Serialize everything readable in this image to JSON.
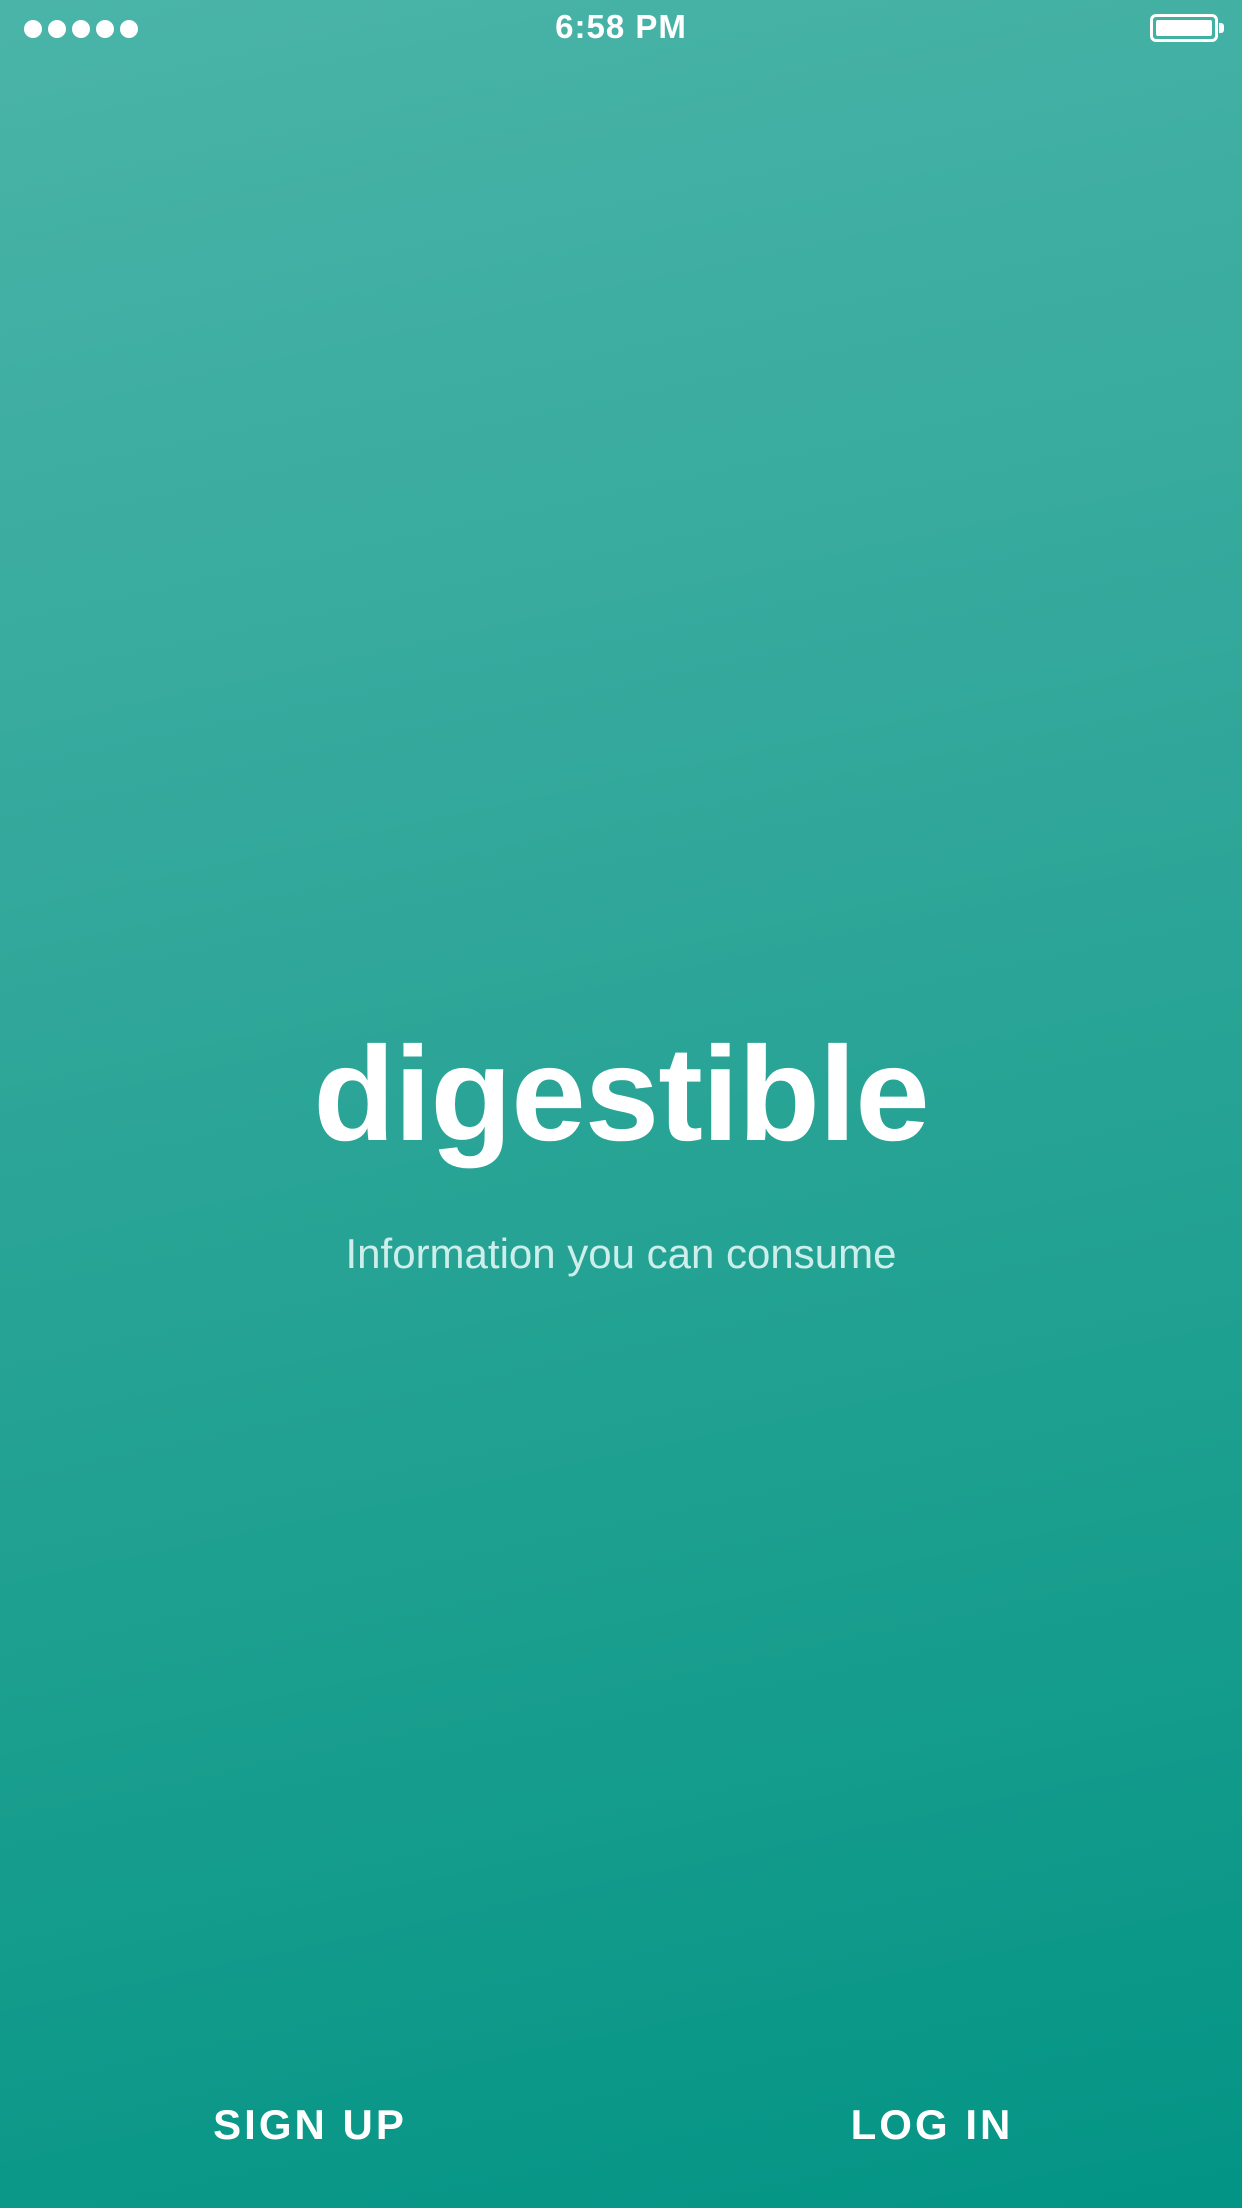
{
  "status_bar": {
    "signal_icon": "signal-dots-icon",
    "time": "6:58 PM",
    "battery_icon": "battery-full-icon"
  },
  "brand": {
    "title": "digestible",
    "tagline": "Information you can consume"
  },
  "actions": {
    "signup_label": "SIGN UP",
    "login_label": "LOG IN"
  },
  "colors": {
    "gradient_top": "#4ab4a8",
    "gradient_bottom": "#039485",
    "text_primary": "#ffffff",
    "text_secondary": "#cdeeea"
  }
}
